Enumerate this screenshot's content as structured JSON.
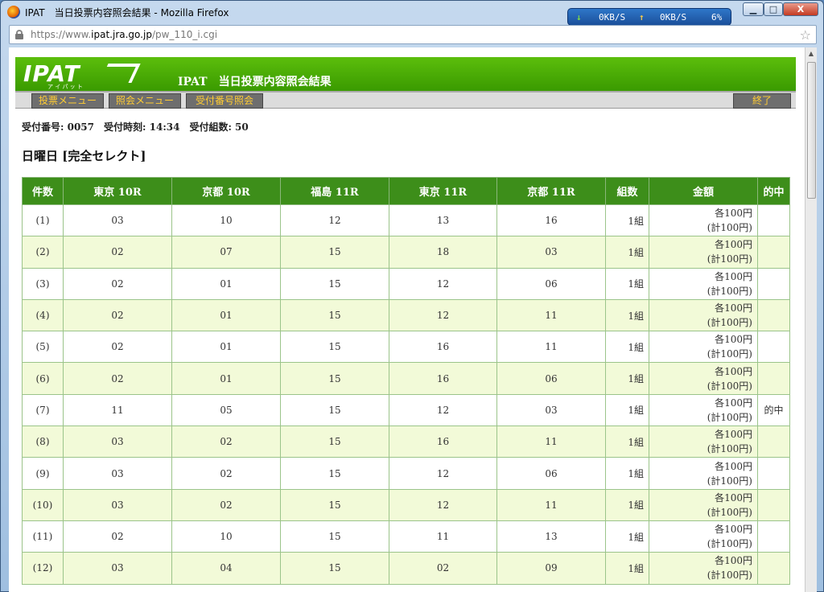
{
  "browser": {
    "window_title": "IPAT　当日投票内容照会結果 - Mozilla Firefox",
    "net_down": "0KB/S",
    "net_up": "0KB/S",
    "net_pct": "6%",
    "url_prefix": "https://www.",
    "url_domain": "ipat.jra.go.jp",
    "url_path": "/pw_110_i.cgi",
    "minimize": "▁",
    "maximize": "□",
    "close": "X"
  },
  "page": {
    "logo": "IPAT",
    "logo_sub": "ア イ パ ッ ト",
    "title": "IPAT　当日投票内容照会結果",
    "nav": {
      "vote_menu": "投票メニュー",
      "inquiry_menu": "照会メニュー",
      "receipt_inquiry": "受付番号照会",
      "exit": "終了"
    },
    "info": "受付番号: 0057　受付時刻: 14:34　受付組数: 50",
    "day_heading": "日曜日 [完全セレクト]"
  },
  "table": {
    "headers": [
      "件数",
      "東京 10R",
      "京都 10R",
      "福島 11R",
      "東京 11R",
      "京都 11R",
      "組数",
      "金額",
      "的中"
    ],
    "rows": [
      [
        "(1)",
        "03",
        "10",
        "12",
        "13",
        "16",
        "1組",
        "各100円",
        "(計100円)",
        ""
      ],
      [
        "(2)",
        "02",
        "07",
        "15",
        "18",
        "03",
        "1組",
        "各100円",
        "(計100円)",
        ""
      ],
      [
        "(3)",
        "02",
        "01",
        "15",
        "12",
        "06",
        "1組",
        "各100円",
        "(計100円)",
        ""
      ],
      [
        "(4)",
        "02",
        "01",
        "15",
        "12",
        "11",
        "1組",
        "各100円",
        "(計100円)",
        ""
      ],
      [
        "(5)",
        "02",
        "01",
        "15",
        "16",
        "11",
        "1組",
        "各100円",
        "(計100円)",
        ""
      ],
      [
        "(6)",
        "02",
        "01",
        "15",
        "16",
        "06",
        "1組",
        "各100円",
        "(計100円)",
        ""
      ],
      [
        "(7)",
        "11",
        "05",
        "15",
        "12",
        "03",
        "1組",
        "各100円",
        "(計100円)",
        "的中"
      ],
      [
        "(8)",
        "03",
        "02",
        "15",
        "16",
        "11",
        "1組",
        "各100円",
        "(計100円)",
        ""
      ],
      [
        "(9)",
        "03",
        "02",
        "15",
        "12",
        "06",
        "1組",
        "各100円",
        "(計100円)",
        ""
      ],
      [
        "(10)",
        "03",
        "02",
        "15",
        "12",
        "11",
        "1組",
        "各100円",
        "(計100円)",
        ""
      ],
      [
        "(11)",
        "02",
        "10",
        "15",
        "11",
        "13",
        "1組",
        "各100円",
        "(計100円)",
        ""
      ],
      [
        "(12)",
        "03",
        "04",
        "15",
        "02",
        "09",
        "1組",
        "各100円",
        "(計100円)",
        ""
      ]
    ]
  }
}
